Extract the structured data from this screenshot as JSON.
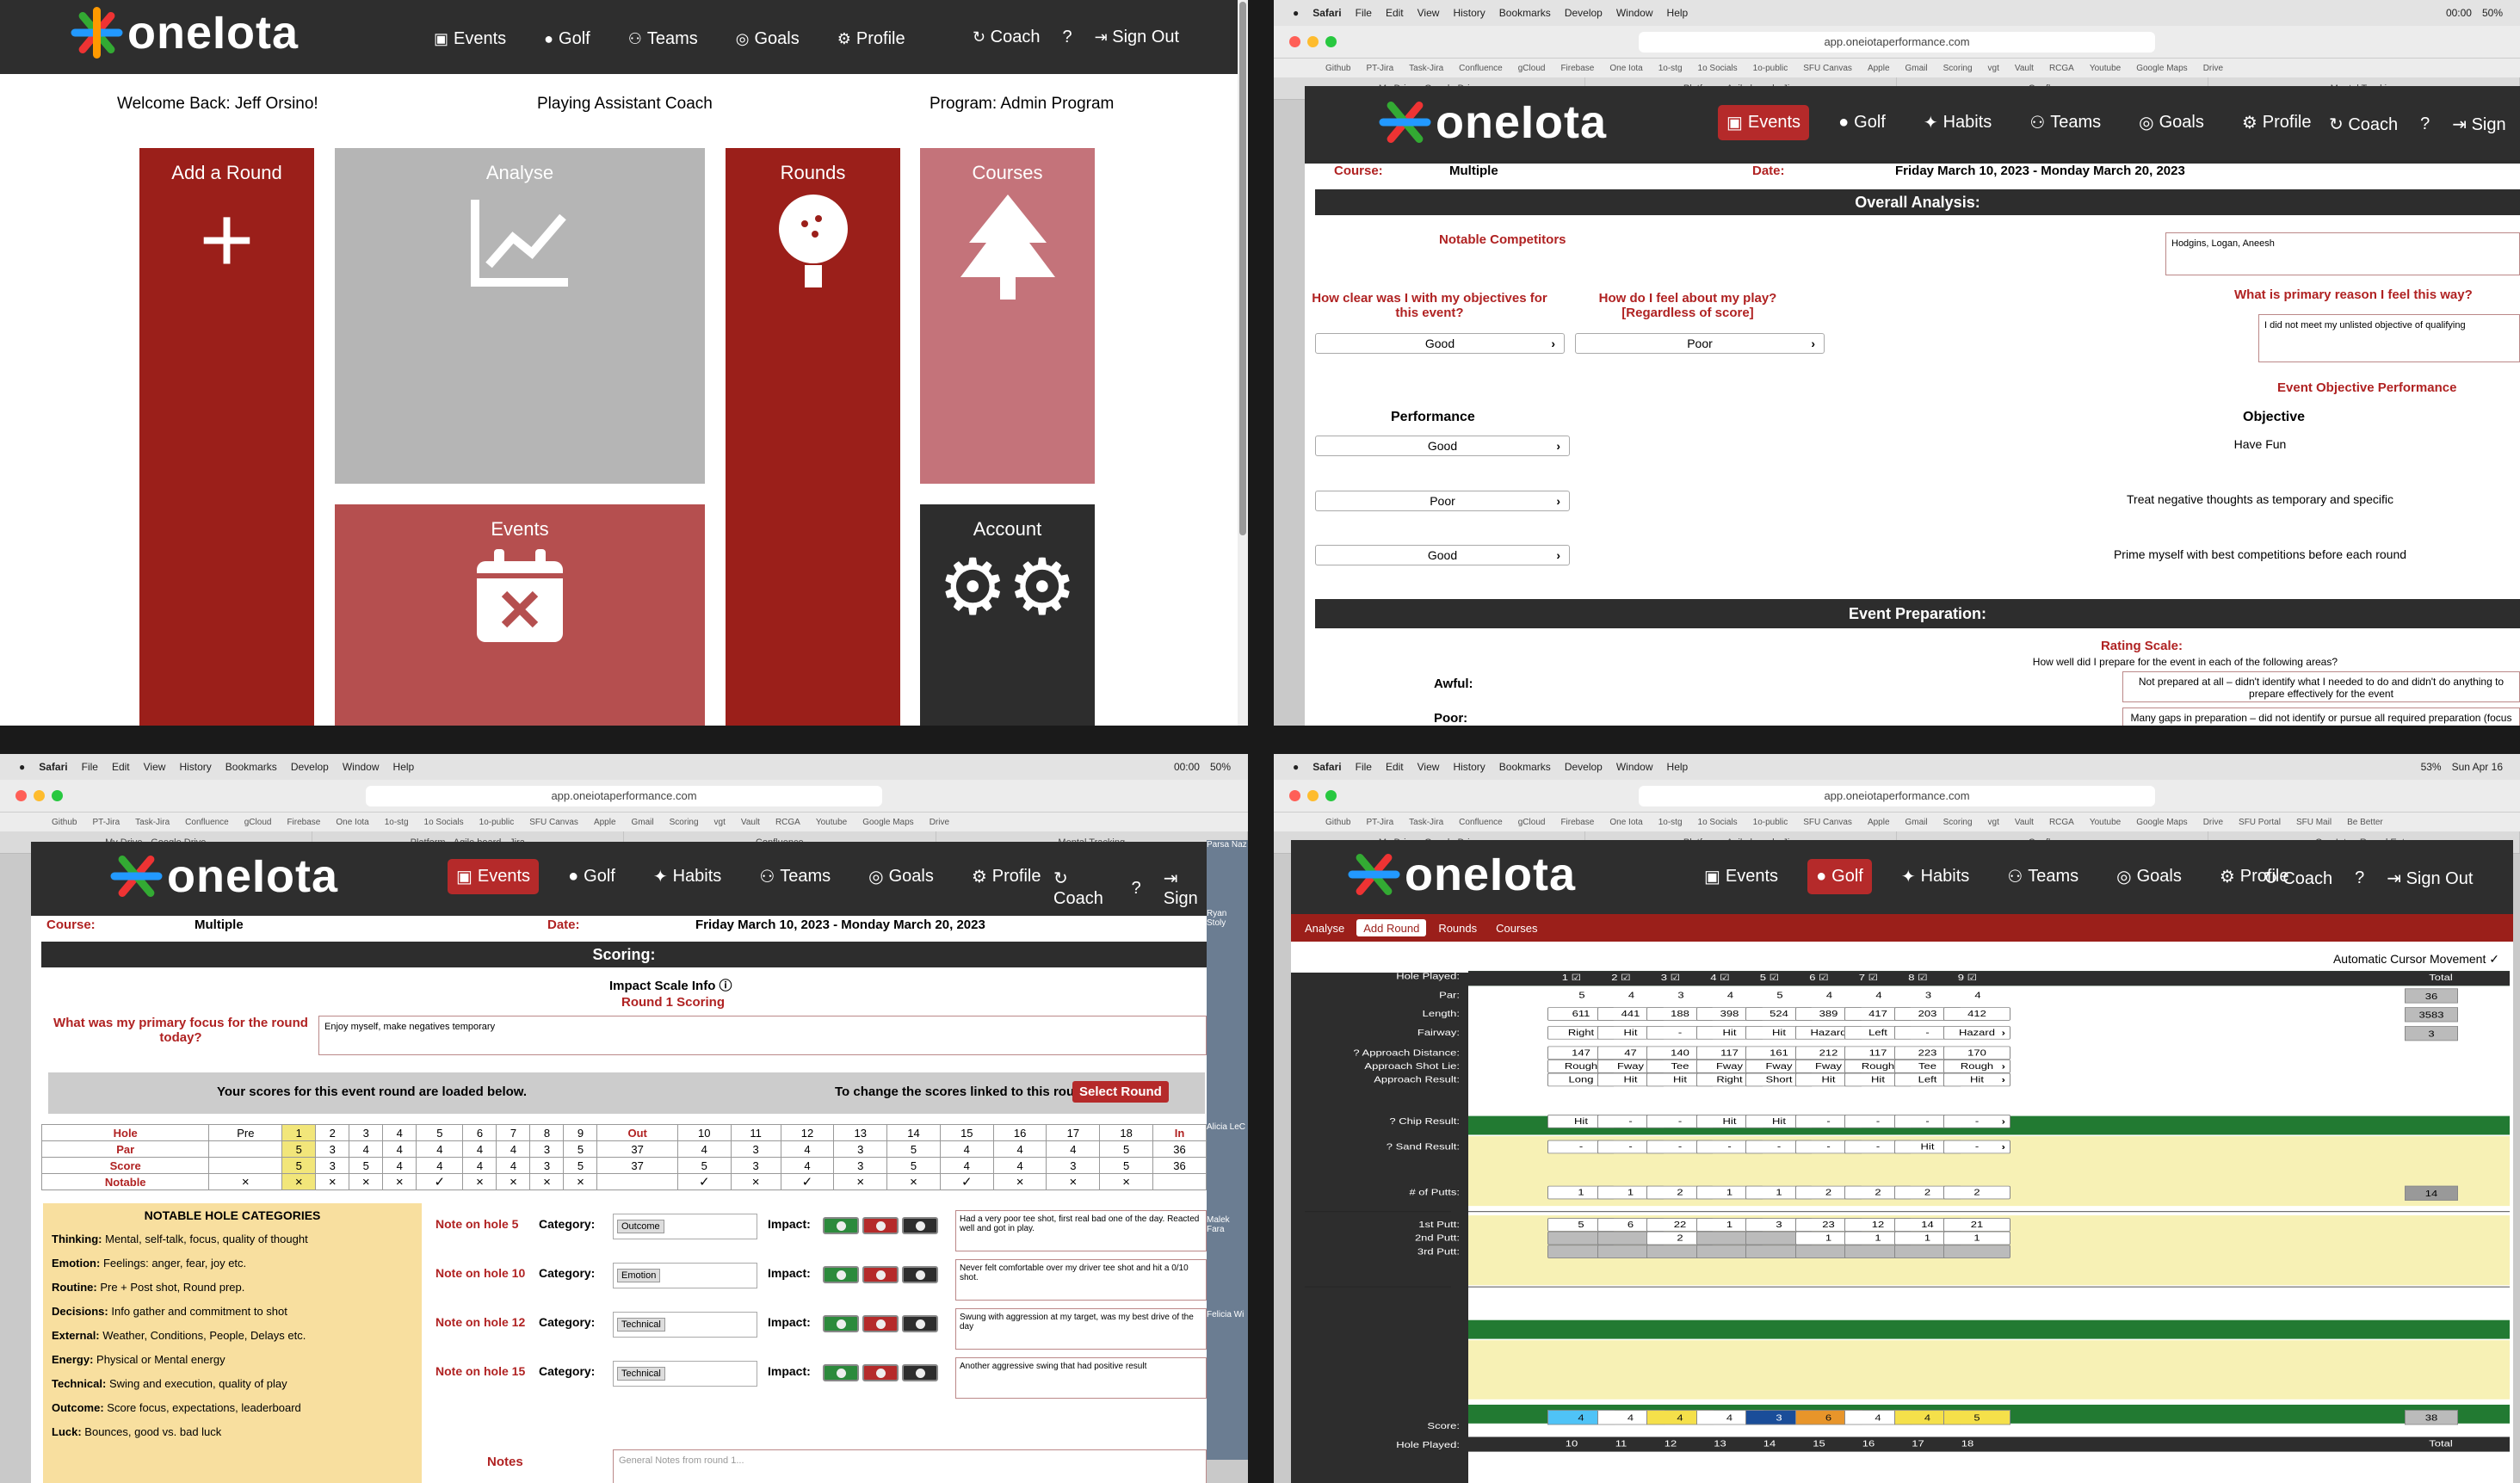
{
  "brand": "oneIota",
  "q1": {
    "nav": {
      "events": "Events",
      "golf": "Golf",
      "teams": "Teams",
      "goals": "Goals",
      "profile": "Profile",
      "coach": "Coach",
      "help": "?",
      "signout": "Sign Out"
    },
    "welcome": "Welcome Back:   Jeff Orsino!",
    "role": "Playing Assistant Coach",
    "program": "Program:   Admin Program",
    "tiles": {
      "add": "Add a Round",
      "analyse": "Analyse",
      "rounds": "Rounds",
      "courses": "Courses",
      "events": "Events",
      "account": "Account"
    }
  },
  "browser": {
    "menu": [
      "Safari",
      "File",
      "Edit",
      "View",
      "History",
      "Bookmarks",
      "Develop",
      "Window",
      "Help"
    ],
    "url": "app.oneiotaperformance.com",
    "favorites": [
      "Github",
      "PT-Jira",
      "Task-Jira",
      "Confluence",
      "gCloud",
      "Firebase",
      "One Iota",
      "1o-stg",
      "1o Socials",
      "1o-public",
      "SFU Canvas",
      "Apple",
      "Gmail",
      "Scoring",
      "vgt",
      "Vault",
      "RCGA",
      "Youtube",
      "Google Maps",
      "Drive",
      "SFU Portal",
      "SFU Mail",
      "Be Better"
    ],
    "tabs": [
      "My Drive - Google Drive",
      "Platform - Agile board - Jira",
      "Confluence",
      "Mental Tracking"
    ],
    "tabs4": [
      "My Drive - Google Drive",
      "Platform - Agile board - Jira",
      "Confluence",
      "One Iota - Round Entry"
    ],
    "time": "00:00",
    "battery": "50%",
    "battery4": "53%",
    "date4": "Sun Apr 16"
  },
  "nav2": {
    "events": "Events",
    "golf": "Golf",
    "habits": "Habits",
    "teams": "Teams",
    "goals": "Goals",
    "profile": "Profile",
    "coach": "Coach",
    "help": "?",
    "signout": "Sign"
  },
  "nav4signout": "Sign Out",
  "q2": {
    "course_label": "Course:",
    "course": "Multiple",
    "date_label": "Date:",
    "date": "Friday March 10, 2023 - Monday March 20, 2023",
    "overall": "Overall Analysis:",
    "competitors_label": "Notable Competitors",
    "competitors": "Hodgins, Logan, Aneesh",
    "q_clear": "How clear was I with my objectives for this event?",
    "q_feel": "How do I feel about my play? [Regardless of score]",
    "q_reason": "What is primary reason I feel this way?",
    "clear_val": "Good",
    "feel_val": "Poor",
    "reason": "I did not meet my unlisted objective of qualifying",
    "eop": "Event Objective Performance",
    "perf_hdr": "Performance",
    "obj_hdr": "Objective",
    "objectives": [
      {
        "perf": "Good",
        "obj": "Have Fun"
      },
      {
        "perf": "Poor",
        "obj": "Treat negative thoughts as temporary and specific"
      },
      {
        "perf": "Good",
        "obj": "Prime myself with best competitions before each round"
      }
    ],
    "prep": "Event Preparation:",
    "rating": "Rating Scale:",
    "rating_q": "How well did I prepare for the event in each of the following areas?",
    "awful": "Awful:",
    "awful_txt": "Not prepared at all – didn't identify what I needed to do and didn't do anything to prepare effectively for the event",
    "poor": "Poor:",
    "poor_txt": "Many gaps in preparation – did not identify or pursue all required preparation (focus and/or effort problem)"
  },
  "q3": {
    "scoring": "Scoring:",
    "impact": "Impact Scale Info",
    "round": "Round 1 Scoring",
    "focus_q": "What was my primary focus for the round today?",
    "focus": "Enjoy myself, make negatives temporary",
    "loaded": "Your scores for this event round are loaded below.",
    "change": "To change the scores linked to this round:",
    "select": "Select Round",
    "holes": [
      "Hole",
      "Pre",
      "1",
      "2",
      "3",
      "4",
      "5",
      "6",
      "7",
      "8",
      "9",
      "Out",
      "10",
      "11",
      "12",
      "13",
      "14",
      "15",
      "16",
      "17",
      "18",
      "In"
    ],
    "par": [
      "Par",
      "",
      "5",
      "3",
      "4",
      "4",
      "4",
      "4",
      "4",
      "3",
      "5",
      "37",
      "4",
      "3",
      "4",
      "3",
      "5",
      "4",
      "4",
      "4",
      "5",
      "36"
    ],
    "score": [
      "Score",
      "",
      "5",
      "3",
      "5",
      "4",
      "4",
      "4",
      "4",
      "3",
      "5",
      "37",
      "5",
      "3",
      "4",
      "3",
      "5",
      "4",
      "4",
      "3",
      "5",
      "36"
    ],
    "notable": [
      "Notable",
      "×",
      "×",
      "×",
      "×",
      "×",
      "✓",
      "×",
      "×",
      "×",
      "×",
      "",
      "✓",
      "×",
      "✓",
      "×",
      "×",
      "✓",
      "×",
      "×",
      "×",
      ""
    ],
    "cat_title": "NOTABLE HOLE CATEGORIES",
    "cats": [
      [
        "Thinking:",
        "Mental, self-talk, focus, quality of thought"
      ],
      [
        "Emotion:",
        "Feelings: anger, fear, joy etc."
      ],
      [
        "Routine:",
        "Pre + Post shot, Round prep."
      ],
      [
        "Decisions:",
        "Info gather and commitment to shot"
      ],
      [
        "External:",
        "Weather, Conditions, People, Delays etc."
      ],
      [
        "Energy:",
        "Physical or Mental energy"
      ],
      [
        "Technical:",
        "Swing and execution, quality of play"
      ],
      [
        "Outcome:",
        "Score focus, expectations, leaderboard"
      ],
      [
        "Luck:",
        "Bounces, good vs. bad luck"
      ]
    ],
    "notes": [
      {
        "hole": "Note on hole 5",
        "cat": "Outcome",
        "text": "Had a very poor tee shot, first real bad one of the day. Reacted well and got in play."
      },
      {
        "hole": "Note on hole 10",
        "cat": "Emotion",
        "text": "Never felt comfortable over my driver tee shot and hit a 0/10 shot."
      },
      {
        "hole": "Note on hole 12",
        "cat": "Technical",
        "text": "Swung with aggression at my target, was my best drive of the day"
      },
      {
        "hole": "Note on hole 15",
        "cat": "Technical",
        "text": "Another aggressive swing that had positive result"
      }
    ],
    "category_label": "Category:",
    "impact_label": "Impact:",
    "notes_title": "Notes",
    "notes_ph": "General Notes from round 1...",
    "side_names": [
      "Parsa Naz",
      "Ryan Stoly",
      "Alicia LeC",
      "Malek Fara",
      "Felicia Wi"
    ]
  },
  "q4": {
    "subtabs": [
      "Analyse",
      "Add Round",
      "Rounds",
      "Courses"
    ],
    "auto": "Automatic Cursor Movement",
    "labels": {
      "played": "Hole Played:",
      "par": "Par:",
      "length": "Length:",
      "fairway": "Fairway:",
      "appdist": "Approach Distance:",
      "applie": "Approach Shot Lie:",
      "appres": "Approach Result:",
      "chip": "Chip Result:",
      "sand": "Sand Result:",
      "putts": "# of Putts:",
      "p1": "1st Putt:",
      "p2": "2nd Putt:",
      "p3": "3rd Putt:",
      "score": "Score:",
      "played2": "Hole Played:"
    },
    "holes": [
      "1",
      "2",
      "3",
      "4",
      "5",
      "6",
      "7",
      "8",
      "9"
    ],
    "total": "Total",
    "par": [
      "5",
      "4",
      "3",
      "4",
      "5",
      "4",
      "4",
      "3",
      "4"
    ],
    "par_total": "36",
    "length": [
      "611",
      "441",
      "188",
      "398",
      "524",
      "389",
      "417",
      "203",
      "412"
    ],
    "length_total": "3583",
    "fairway": [
      "Right",
      "Hit",
      "-",
      "Hit",
      "Hit",
      "Hazard",
      "Left",
      "-",
      "Hazard"
    ],
    "fairway_total": "3",
    "appdist": [
      "147",
      "47",
      "140",
      "117",
      "161",
      "212",
      "117",
      "223",
      "170"
    ],
    "applie": [
      "Rough",
      "Fway",
      "Tee",
      "Fway",
      "Fway",
      "Fway",
      "Rough",
      "Tee",
      "Rough"
    ],
    "appres": [
      "Long",
      "Hit",
      "Hit",
      "Right",
      "Short",
      "Hit",
      "Hit",
      "Left",
      "Hit"
    ],
    "chip": [
      "Hit",
      "-",
      "-",
      "Hit",
      "Hit",
      "-",
      "-",
      "-",
      "-"
    ],
    "sand": [
      "-",
      "-",
      "-",
      "-",
      "-",
      "-",
      "-",
      "Hit",
      "-"
    ],
    "putts": [
      "1",
      "1",
      "2",
      "1",
      "1",
      "2",
      "2",
      "2",
      "2"
    ],
    "putts_total": "14",
    "p1": [
      "5",
      "6",
      "22",
      "1",
      "3",
      "23",
      "12",
      "14",
      "21"
    ],
    "p2": [
      "",
      "",
      "2",
      "",
      "",
      "1",
      "1",
      "1",
      "1"
    ],
    "p3": [
      "",
      "",
      "",
      "",
      "",
      "",
      "",
      "",
      ""
    ],
    "score": [
      "4",
      "4",
      "4",
      "4",
      "3",
      "6",
      "4",
      "4",
      "5"
    ],
    "score_total": "38",
    "next": [
      "10",
      "11",
      "12",
      "13",
      "14",
      "15",
      "16",
      "17",
      "18"
    ],
    "next_total": "Total",
    "colors": {
      "birdie": "#4fc3f7",
      "eagle": "#1a4d99",
      "bogey": "#f5e04a",
      "double": "#e8952a",
      "par": "#ffffff"
    }
  }
}
